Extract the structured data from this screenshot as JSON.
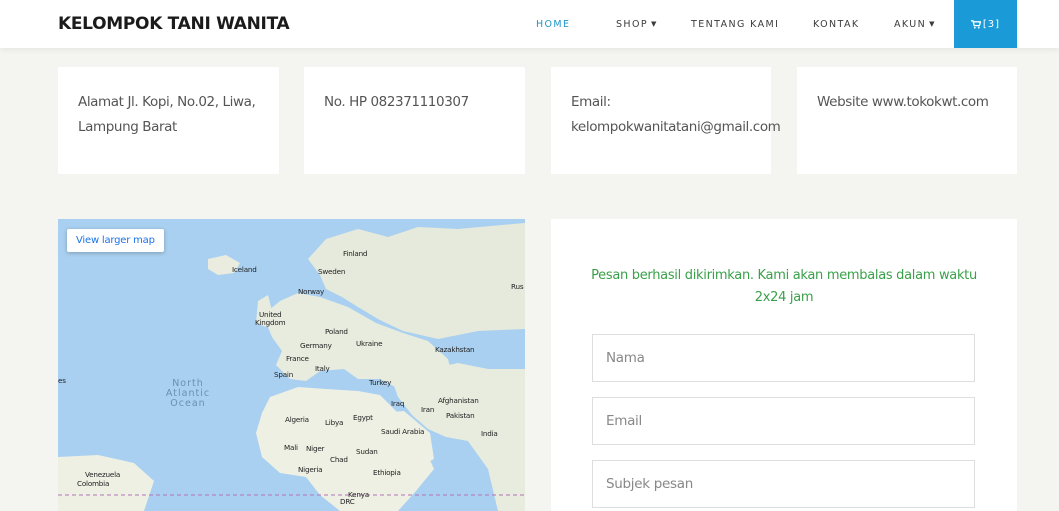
{
  "navbar": {
    "brand": "KELOMPOK TANI WANITA",
    "items": [
      {
        "label": "HOME",
        "active": true
      },
      {
        "label": "SHOP",
        "dropdown": true
      },
      {
        "label": "TENTANG KAMI"
      },
      {
        "label": "KONTAK"
      },
      {
        "label": "AKUN",
        "dropdown": true
      }
    ],
    "cart_count": "[3]",
    "cart_icon": "cart-icon",
    "accent_color": "#1a9ad6"
  },
  "info_cards": [
    {
      "text": "Alamat Jl. Kopi, No.02, Liwa, Lampung Barat"
    },
    {
      "text": "No. HP 082371110307"
    },
    {
      "line1": "Email:",
      "line2": "kelompokwanitatani@gmail.com"
    },
    {
      "text": "Website www.tokokwt.com"
    }
  ],
  "map": {
    "button_label": "View larger map",
    "labels": {
      "finland": "Finland",
      "iceland": "Iceland",
      "sweden": "Sweden",
      "rus": "Rus",
      "norway": "Norway",
      "united_kingdom_1": "United",
      "united_kingdom_2": "Kingdom",
      "poland": "Poland",
      "germany": "Germany",
      "ukraine": "Ukraine",
      "kazakhstan": "Kazakhstan",
      "france": "France",
      "italy": "Italy",
      "spain": "Spain",
      "turkey": "Turkey",
      "es": "es",
      "ocean_1": "North",
      "ocean_2": "Atlantic",
      "ocean_3": "Ocean",
      "iraq": "Iraq",
      "iran": "Iran",
      "afghanistan": "Afghanistan",
      "pakistan": "Pakistan",
      "algeria": "Algeria",
      "libya": "Libya",
      "egypt": "Egypt",
      "saudi_arabia": "Saudi Arabia",
      "india": "India",
      "mali": "Mali",
      "niger": "Niger",
      "chad": "Chad",
      "sudan": "Sudan",
      "nigeria": "Nigeria",
      "ethiopia": "Ethiopia",
      "venezuela": "Venezuela",
      "colombia": "Colombia",
      "kenya": "Kenya",
      "drc": "DRC"
    }
  },
  "contact_form": {
    "success_message": "Pesan berhasil dikirimkan. Kami akan membalas dalam waktu 2x24 jam",
    "success_color": "#3aa04a",
    "fields": [
      {
        "placeholder": "Nama"
      },
      {
        "placeholder": "Email"
      },
      {
        "placeholder": "Subjek pesan"
      }
    ]
  }
}
